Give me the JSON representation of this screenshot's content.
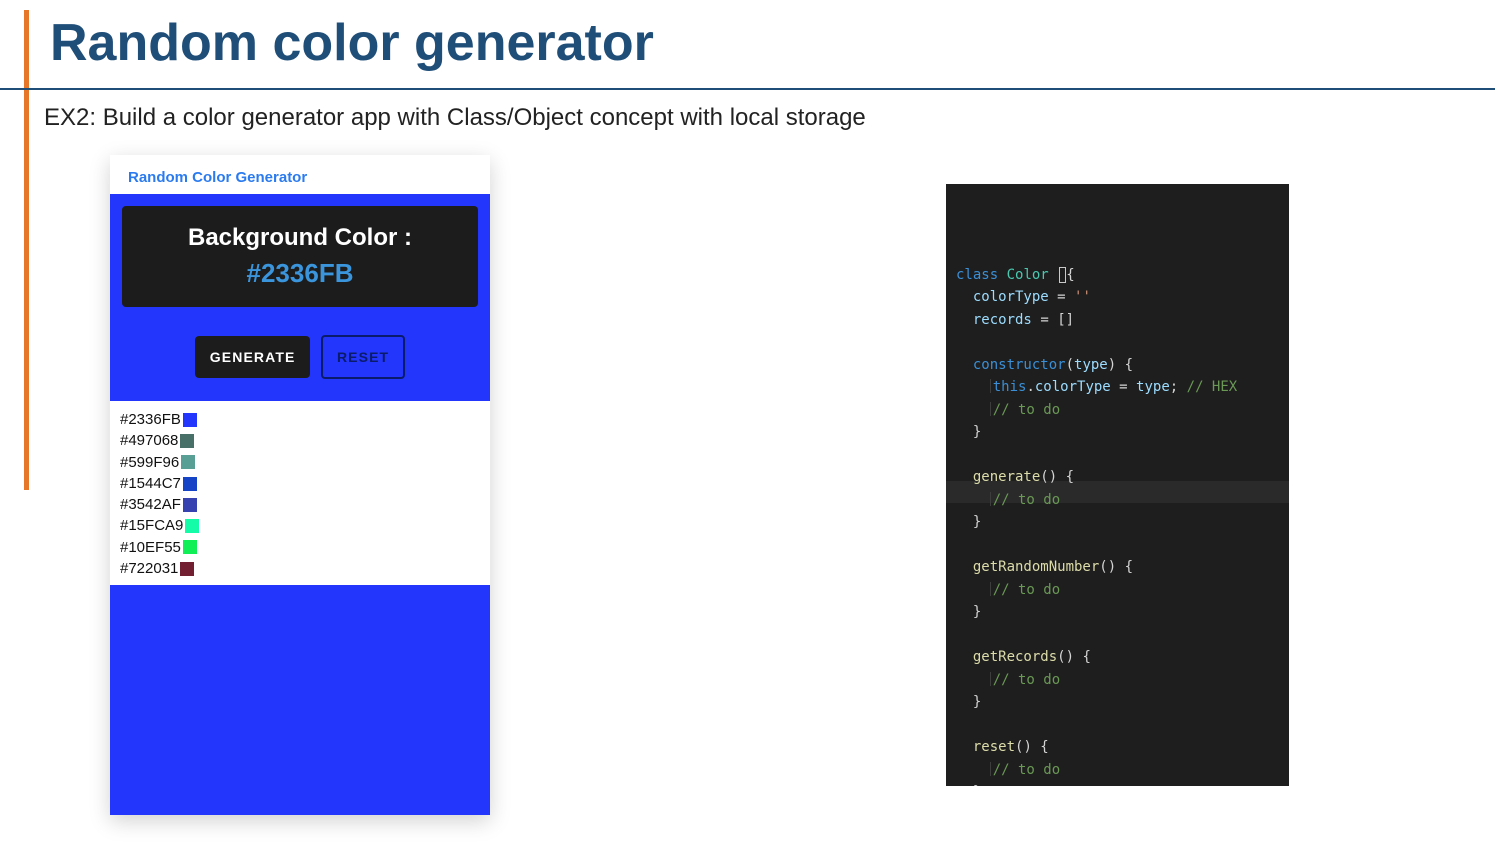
{
  "slide": {
    "title": "Random color generator",
    "subtitle": "EX2: Build a color generator app with Class/Object concept with local storage"
  },
  "app": {
    "header": "Random Color Generator",
    "label_title": "Background Color :",
    "current_hex": "#2336FB",
    "canvas_color": "#2336FB",
    "buttons": {
      "generate": "GENERATE",
      "reset": "RESET"
    },
    "records": [
      {
        "hex": "#2336FB",
        "swatch": "#2336FB"
      },
      {
        "hex": "#497068",
        "swatch": "#497068"
      },
      {
        "hex": "#599F96",
        "swatch": "#599F96"
      },
      {
        "hex": "#1544C7",
        "swatch": "#1544C7"
      },
      {
        "hex": "#3542AF",
        "swatch": "#3542AF"
      },
      {
        "hex": "#15FCA9",
        "swatch": "#15FCA9"
      },
      {
        "hex": "#10EF55",
        "swatch": "#10EF55"
      },
      {
        "hex": "#722031",
        "swatch": "#722031"
      }
    ]
  },
  "code": {
    "lines": [
      {
        "type": "class_decl",
        "name": "Color"
      },
      {
        "type": "prop",
        "name": "colorType",
        "value": "''"
      },
      {
        "type": "prop",
        "name": "records",
        "value": "[]"
      },
      {
        "type": "blank"
      },
      {
        "type": "ctor",
        "param": "type"
      },
      {
        "type": "assign_this",
        "lhs": "colorType",
        "rhs": "type",
        "comment": "// HEX"
      },
      {
        "type": "todo"
      },
      {
        "type": "close"
      },
      {
        "type": "blank"
      },
      {
        "type": "method",
        "name": "generate"
      },
      {
        "type": "todo"
      },
      {
        "type": "close"
      },
      {
        "type": "hl_blank"
      },
      {
        "type": "method",
        "name": "getRandomNumber"
      },
      {
        "type": "todo"
      },
      {
        "type": "close"
      },
      {
        "type": "blank"
      },
      {
        "type": "method",
        "name": "getRecords"
      },
      {
        "type": "todo"
      },
      {
        "type": "close"
      },
      {
        "type": "blank"
      },
      {
        "type": "method",
        "name": "reset"
      },
      {
        "type": "todo"
      },
      {
        "type": "close"
      },
      {
        "type": "class_close"
      }
    ],
    "todo_text": "// to do",
    "hex_comment": "// HEX"
  }
}
